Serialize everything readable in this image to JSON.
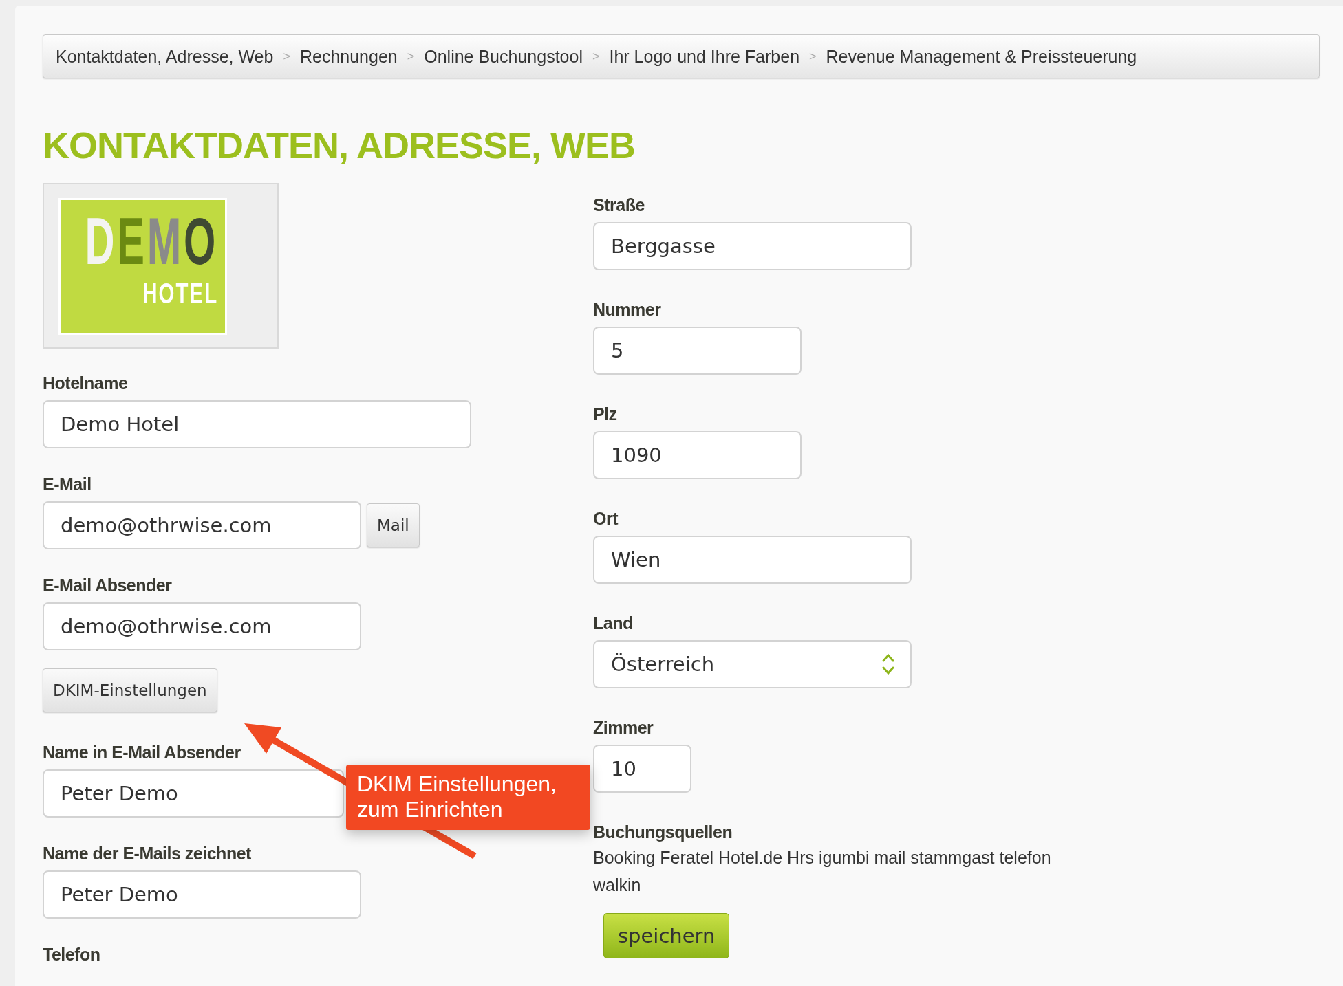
{
  "breadcrumbs": [
    {
      "label": "Kontaktdaten, Adresse, Web",
      "separator": ">"
    },
    {
      "label": "Rechnungen",
      "separator": ">"
    },
    {
      "label": "Online Buchungstool",
      "separator": ">"
    },
    {
      "label": "Ihr Logo und Ihre Farben",
      "separator": ">"
    },
    {
      "label": "Revenue Management & Preissteuerung"
    }
  ],
  "heading": "KONTAKTDATEN, ADRESSE, WEB",
  "logo": {
    "word": "DEMO",
    "subtitle": "HOTEL"
  },
  "left_fields": [
    {
      "kind": "input",
      "label": "Hotelname",
      "value": "Demo Hotel"
    },
    {
      "kind": "input",
      "label": "E-Mail",
      "value": "demo@othrwise.com",
      "button": "Mail"
    },
    {
      "kind": "input",
      "label": "E-Mail Absender",
      "value": "demo@othrwise.com"
    },
    {
      "kind": "button",
      "label": "DKIM-Einstellungen"
    },
    {
      "kind": "input",
      "label": "Name in E-Mail Absender",
      "value": "Peter Demo"
    },
    {
      "kind": "input",
      "label": "Name der E-Mails zeichnet",
      "value": "Peter Demo"
    },
    {
      "kind": "label",
      "label": "Telefon"
    }
  ],
  "right_fields": [
    {
      "kind": "input",
      "label": "Straße",
      "value": "Berggasse"
    },
    {
      "kind": "input",
      "label": "Nummer",
      "value": "5"
    },
    {
      "kind": "input",
      "label": "Plz",
      "value": "1090"
    },
    {
      "kind": "input",
      "label": "Ort",
      "value": "Wien"
    },
    {
      "kind": "select",
      "label": "Land",
      "value": "Österreich"
    },
    {
      "kind": "input",
      "label": "Zimmer",
      "value": "10"
    },
    {
      "kind": "text",
      "label": "Buchungsquellen",
      "text": "Booking Feratel Hotel.de Hrs igumbi mail stammgast telefon walkin"
    },
    {
      "kind": "primary_button",
      "label": "speichern"
    }
  ],
  "callout": {
    "text": "DKIM Einstellungen, zum Einrichten"
  }
}
